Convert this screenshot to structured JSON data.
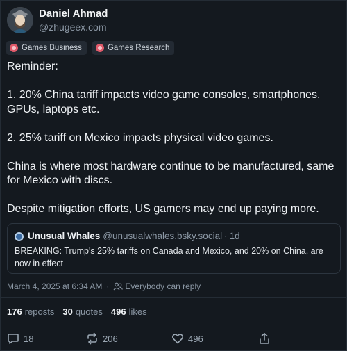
{
  "author": {
    "display_name": "Daniel Ahmad",
    "handle": "@zhugeex.com"
  },
  "tags": [
    {
      "label": "Games Business",
      "icon": "feed-icon"
    },
    {
      "label": "Games Research",
      "icon": "feed-icon"
    }
  ],
  "post": {
    "text": "Reminder:\n\n1. 20% China tariff impacts video game consoles, smartphones, GPUs, laptops etc.\n\n2. 25% tariff on Mexico impacts physical video games.\n\nChina is where most hardware continue to be manufactured, same for Mexico with discs.\n\nDespite mitigation efforts, US gamers may end up paying more."
  },
  "quote": {
    "name": "Unusual Whales",
    "handle": "@unusualwhales.bsky.social",
    "age": "1d",
    "text": "BREAKING: Trump's 25% tariffs on Canada and Mexico, and 20% on China, are now in effect"
  },
  "meta": {
    "timestamp": "March 4, 2025 at 6:34 AM",
    "separator": "·",
    "reply_setting": "Everybody can reply"
  },
  "stats": {
    "reposts_count": "176",
    "reposts_label": "reposts",
    "quotes_count": "30",
    "quotes_label": "quotes",
    "likes_count": "496",
    "likes_label": "likes"
  },
  "actions": {
    "reply_count": "18",
    "repost_count": "206",
    "like_count": "496"
  },
  "colors": {
    "background": "#14191f",
    "text": "#e7eaee",
    "muted": "#8b97a4"
  }
}
